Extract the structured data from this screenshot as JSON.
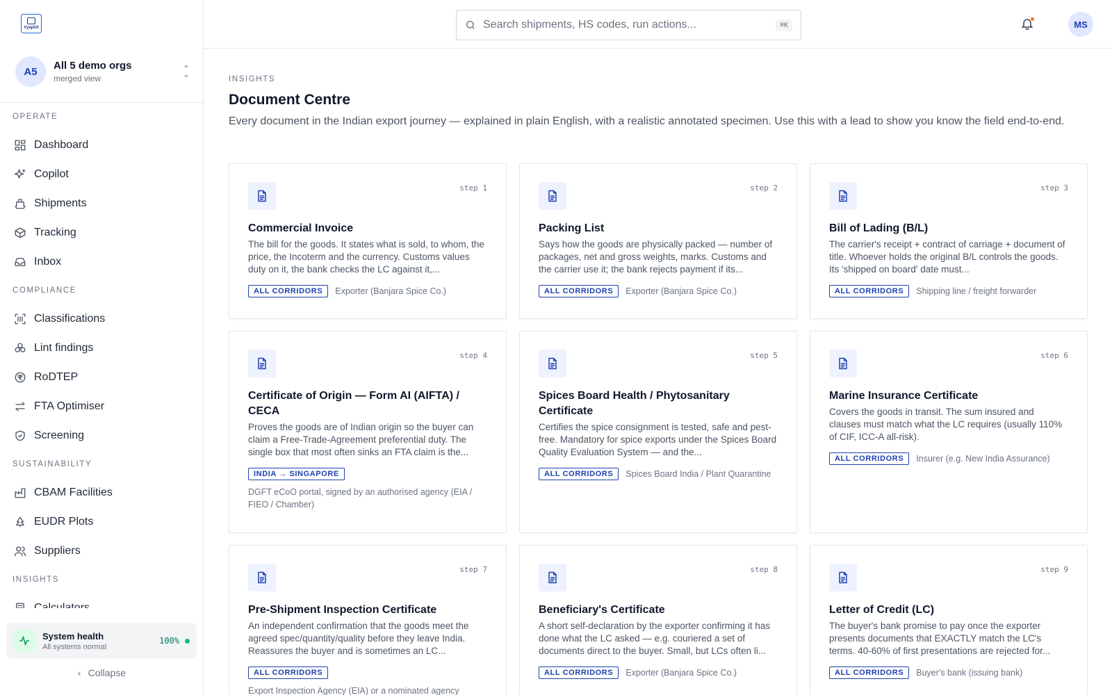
{
  "brand": {
    "logo_text": "VyaptiX"
  },
  "org": {
    "avatar": "A5",
    "name": "All 5 demo orgs",
    "subtitle": "merged view"
  },
  "nav": {
    "operate_label": "OPERATE",
    "operate": [
      {
        "label": "Dashboard",
        "icon": "grid-icon"
      },
      {
        "label": "Copilot",
        "icon": "sparkles-icon"
      },
      {
        "label": "Shipments",
        "icon": "ship-icon"
      },
      {
        "label": "Tracking",
        "icon": "box-icon"
      },
      {
        "label": "Inbox",
        "icon": "inbox-icon"
      }
    ],
    "compliance_label": "COMPLIANCE",
    "compliance": [
      {
        "label": "Classifications",
        "icon": "scan-icon"
      },
      {
        "label": "Lint findings",
        "icon": "biohazard-icon"
      },
      {
        "label": "RoDTEP",
        "icon": "rupee-icon"
      },
      {
        "label": "FTA Optimiser",
        "icon": "arrows-icon"
      },
      {
        "label": "Screening",
        "icon": "shield-icon"
      }
    ],
    "sustainability_label": "SUSTAINABILITY",
    "sustainability": [
      {
        "label": "CBAM Facilities",
        "icon": "factory-icon"
      },
      {
        "label": "EUDR Plots",
        "icon": "tree-icon"
      },
      {
        "label": "Suppliers",
        "icon": "users-icon"
      }
    ],
    "insights_label": "INSIGHTS",
    "insights": [
      {
        "label": "Calculators",
        "icon": "calculator-icon"
      }
    ]
  },
  "health": {
    "title": "System health",
    "subtitle": "All systems normal",
    "percent": "100%"
  },
  "collapse_label": "Collapse",
  "search": {
    "placeholder": "Search shipments, HS codes, run actions...",
    "shortcut": "⌘K"
  },
  "user": {
    "initials": "MS"
  },
  "page": {
    "eyebrow": "INSIGHTS",
    "title": "Document Centre",
    "description": "Every document in the Indian export journey — explained in plain English, with a realistic annotated specimen. Use this with a lead to show you know the field end-to-end."
  },
  "documents": [
    {
      "step": "step 1",
      "title": "Commercial Invoice",
      "desc": "The bill for the goods. It states what is sold, to whom, the price, the Incoterm and the currency. Customs values duty on it, the bank checks the LC against it,...",
      "badge": "ALL CORRIDORS",
      "issuer": "Exporter (Banjara Spice Co.)"
    },
    {
      "step": "step 2",
      "title": "Packing List",
      "desc": "Says how the goods are physically packed — number of packages, net and gross weights, marks. Customs and the carrier use it; the bank rejects payment if its...",
      "badge": "ALL CORRIDORS",
      "issuer": "Exporter (Banjara Spice Co.)"
    },
    {
      "step": "step 3",
      "title": "Bill of Lading (B/L)",
      "desc": "The carrier's receipt + contract of carriage + document of title. Whoever holds the original B/L controls the goods. Its 'shipped on board' date must...",
      "badge": "ALL CORRIDORS",
      "issuer": "Shipping line / freight forwarder"
    },
    {
      "step": "step 4",
      "title": "Certificate of Origin — Form AI (AIFTA) / CECA",
      "desc": "Proves the goods are of Indian origin so the buyer can claim a Free-Trade-Agreement preferential duty. The single box that most often sinks an FTA claim is the...",
      "badge": "INDIA → SINGAPORE",
      "issuer": "DGFT eCoO portal, signed by an authorised agency (EIA / FIEO / Chamber)"
    },
    {
      "step": "step 5",
      "title": "Spices Board Health / Phytosanitary Certificate",
      "desc": "Certifies the spice consignment is tested, safe and pest-free. Mandatory for spice exports under the Spices Board Quality Evaluation System — and the...",
      "badge": "ALL CORRIDORS",
      "issuer": "Spices Board India / Plant Quarantine"
    },
    {
      "step": "step 6",
      "title": "Marine Insurance Certificate",
      "desc": "Covers the goods in transit. The sum insured and clauses must match what the LC requires (usually 110% of CIF, ICC-A all-risk).",
      "badge": "ALL CORRIDORS",
      "issuer": "Insurer (e.g. New India Assurance)"
    },
    {
      "step": "step 7",
      "title": "Pre-Shipment Inspection Certificate",
      "desc": "An independent confirmation that the goods meet the agreed spec/quantity/quality before they leave India. Reassures the buyer and is sometimes an LC...",
      "badge": "ALL CORRIDORS",
      "issuer": "Export Inspection Agency (EIA) or a nominated agency"
    },
    {
      "step": "step 8",
      "title": "Beneficiary's Certificate",
      "desc": "A short self-declaration by the exporter confirming it has done what the LC asked — e.g. couriered a set of documents direct to the buyer. Small, but LCs often li...",
      "badge": "ALL CORRIDORS",
      "issuer": "Exporter (Banjara Spice Co.)"
    },
    {
      "step": "step 9",
      "title": "Letter of Credit (LC)",
      "desc": "The buyer's bank promise to pay once the exporter presents documents that EXACTLY match the LC's terms. 40-60% of first presentations are rejected for...",
      "badge": "ALL CORRIDORS",
      "issuer": "Buyer's bank (issuing bank)"
    }
  ]
}
